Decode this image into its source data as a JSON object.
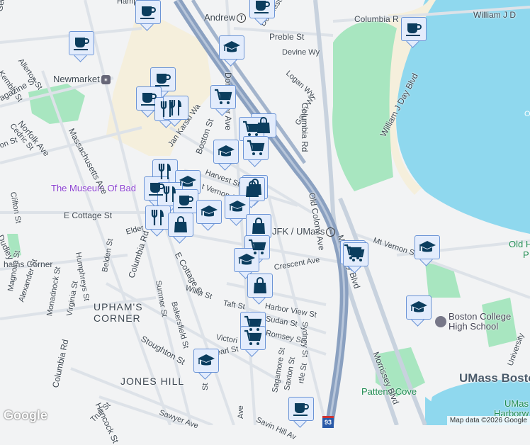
{
  "map": {
    "stations": {
      "andrew": "Andrew",
      "newmarket": "Newmarket",
      "jfk": "JFK / UMass",
      "transit_symbol": "T"
    },
    "poi": {
      "museum": "The Museum Of Bad",
      "bc_high": "Boston College\nHigh School",
      "pattens_cove": "Pattens Cove",
      "old_harbor": "Old H",
      "old_harbor2": "P",
      "umass_boston": "UMass Bosto",
      "umass_harbor": "UMas",
      "umass_harbor2": "Harborw"
    },
    "areas": {
      "uphams": "UPHAM'S\nCORNER",
      "jones_hill": "JONES HILL",
      "uphams_corner_station": "hams Corner"
    },
    "streets": {
      "william_j_day": "William J Day Blvd",
      "william_j": "William J D",
      "columbia_top": "Columbia R",
      "preble": "Preble St",
      "devine": "Devine Wy",
      "logan": "Logan Wy",
      "gavin": "Gavin Wy",
      "columbia_rd_e": "Columbia Rd",
      "dorchester_ave": "Dorchester Ave",
      "dorchester_st": "Dorchester St",
      "allerton": "Allerton St",
      "kemble": "Kemble St",
      "magazine": "agazine St",
      "norfolk": "Norfolk Ave",
      "cedric": "Cedric St",
      "on_st": "on St",
      "mass_ave": "Massachusetts Ave",
      "jan_karski": "Jan Karski Wa",
      "boston_st": "Boston St",
      "harvest": "Harvest St",
      "mt_vernon_w": "t Vernon St",
      "clifton": "Clifton St",
      "e_cottage": "E Cottage St",
      "e_cottage2": "E Cottage St",
      "elder": "Elder St",
      "dudley": "Dudley St",
      "humphreys": "Humphreys St",
      "belden": "Belden St",
      "columbia_rd_w": "Columbia Rd",
      "columbia_rd_sw": "Columbia Rd",
      "magnolia": "Magnolia St",
      "alexander": "Alexander St",
      "monadnock": "Monadnock St",
      "virginia": "Virginia St",
      "sumner": "Sumner St",
      "bakersfield": "Bakersfield St",
      "willis": "Willis St",
      "taft": "Taft St",
      "harbor_view": "Harbor View St",
      "sudan": "Sudan St",
      "romsey": "Romsey St",
      "victoria": "Victori",
      "pearl": "earl St",
      "stoughton": "Stoughton St",
      "hancock": "Hancock St",
      "trull": "Trull St",
      "sawyer": "Sawyer Ave",
      "savin_hill": "Savin Hill Av",
      "sagamore": "Sagamore St",
      "saxton": "Saxton St",
      "myrtle": "rtle St",
      "sydney": "Sydney St",
      "crescent": "Crescent Ave",
      "mt_vernon_e": "Mt Vernon St",
      "old_colony": "Old Colony Ave",
      "morrissey": "Morrissey Blvd",
      "morrissey2": "Morrissey Blvd",
      "university": "University",
      "interstate": "93",
      "st_ave": "Ave",
      "st_st": "St",
      "gerard": "Gera",
      "hampton": "Hamp",
      "o_label": "O"
    },
    "attribution": "Map data ©2026 Google",
    "logo": "Google",
    "colors": {
      "water": "#8fd8ee",
      "park": "#a8e6c0",
      "commercial": "#f5efdc",
      "highway": "#8aa0c0",
      "marker_fill": "#e3ecfc",
      "marker_border": "#6b94d6",
      "icon": "#0b3d5e"
    }
  }
}
